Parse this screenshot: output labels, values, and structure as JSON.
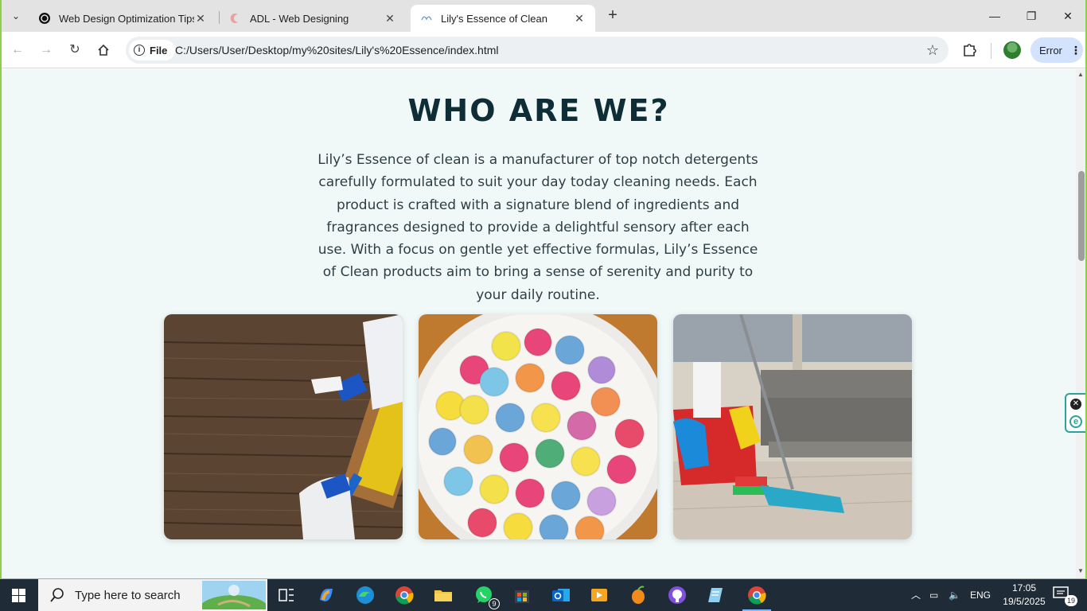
{
  "browser": {
    "tabs": [
      {
        "title": "Web Design Optimization Tips",
        "favicon": "chatgpt-icon",
        "active": false
      },
      {
        "title": "ADL - Web Designing",
        "favicon": "adl-icon",
        "active": false
      },
      {
        "title": "Lily's Essence of Clean",
        "favicon": "lily-icon",
        "active": true
      }
    ],
    "address": {
      "chip_label": "File",
      "url": "C:/Users/User/Desktop/my%20sites/Lily's%20Essence/index.html"
    },
    "profile_button_label": "Error"
  },
  "page": {
    "heading": "WHO ARE WE?",
    "paragraph": "Lily’s Essence of clean is a manufacturer of top notch detergents carefully formulated to suit your day today cleaning needs. Each product is crafted with a signature blend of ingredients and fragrances designed to provide a delightful sensory after each use. With a focus on gentle yet effective formulas, Lily’s Essence of Clean products aim to bring a sense of serenity and purity to your daily routine.",
    "images": [
      {
        "subject": "spray bottles on wooden table"
      },
      {
        "subject": "colorful cleaning tablets in bowl"
      },
      {
        "subject": "cleaning bucket and mop in living room"
      }
    ]
  },
  "taskbar": {
    "search_placeholder": "Type here to search",
    "whatsapp_badge": "9",
    "language": "ENG",
    "time": "17:05",
    "date": "19/5/2025",
    "notification_count": "19"
  }
}
